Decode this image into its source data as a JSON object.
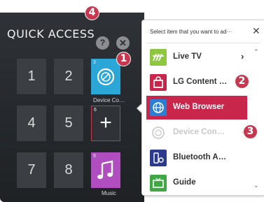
{
  "quick_access": {
    "title": "QUICK ACCESS",
    "help_label": "?",
    "close_label": "✕",
    "tiles": [
      {
        "label": "1"
      },
      {
        "label": "2"
      },
      {
        "slot": "3",
        "caption": "Device Co…"
      },
      {
        "label": "4"
      },
      {
        "label": "5"
      },
      {
        "slot": "6",
        "symbol": "+"
      },
      {
        "label": "7"
      },
      {
        "label": "8"
      },
      {
        "slot": "9",
        "caption": "Music"
      }
    ]
  },
  "callouts": [
    "1",
    "2",
    "3",
    "4"
  ],
  "item_list": {
    "header": "Select item that you want to ad···",
    "close_label": "✕",
    "arrow_right": "›",
    "scroll_up": "⌃",
    "scroll_down": "⌄",
    "check": "✓",
    "items": [
      {
        "label": "Live TV",
        "icon": "antenna-icon",
        "color": "#8dc63f"
      },
      {
        "label": "LG Content …",
        "icon": "shopping-bag-icon",
        "color": "#c9264b"
      },
      {
        "label": "Web Browser",
        "icon": "globe-icon",
        "color": "#2a7fd4"
      },
      {
        "label": "Device Con…",
        "icon": "device-connector-icon",
        "color": "#c8c8c8"
      },
      {
        "label": "Bluetooth A…",
        "icon": "bluetooth-audio-icon",
        "color": "#2b3a8c"
      },
      {
        "label": "Guide",
        "icon": "guide-icon",
        "color": "#3fa845"
      }
    ]
  },
  "colors": {
    "accent": "#c9264b",
    "panel_dark": "#2f3237",
    "device_tile": "#2aa7d6",
    "music_tile": "#b04ec0"
  }
}
